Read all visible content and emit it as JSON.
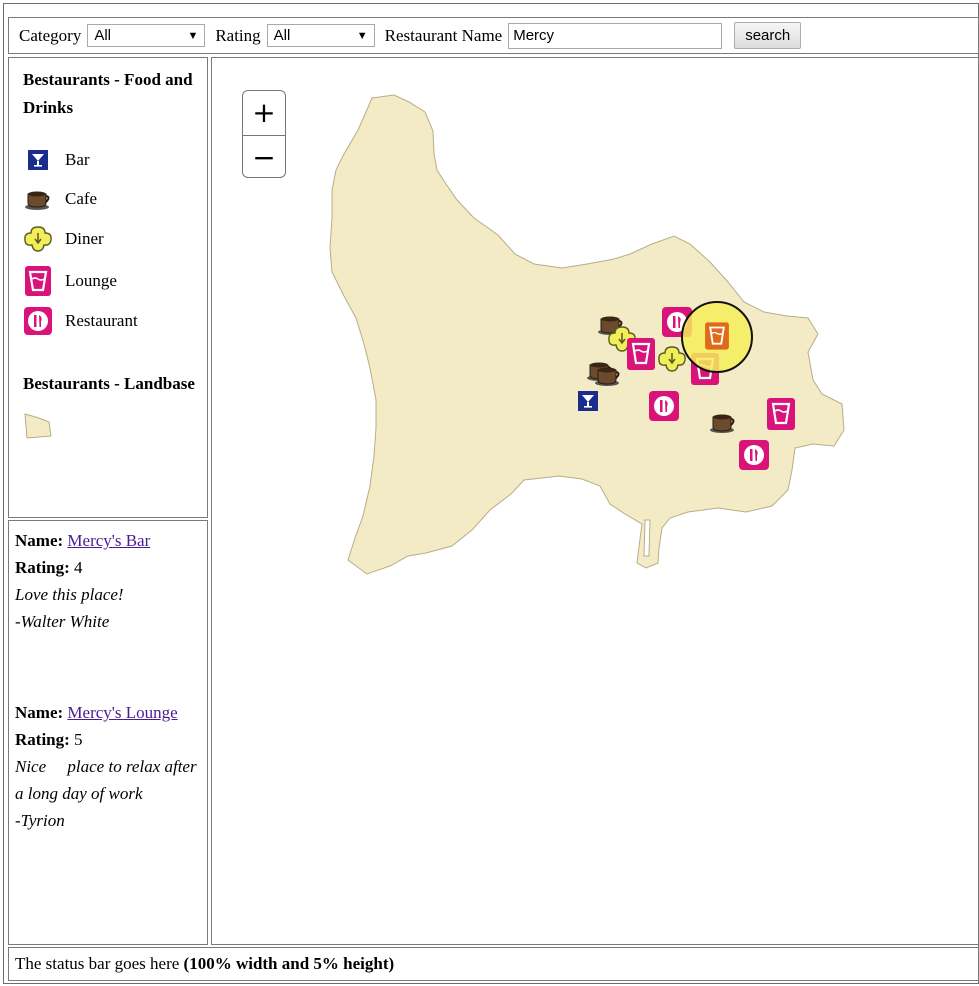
{
  "toolbar": {
    "category_label": "Category",
    "category_value": "All",
    "rating_label": "Rating",
    "rating_value": "All",
    "restaurant_name_label": "Restaurant Name",
    "restaurant_name_value": "Mercy",
    "search_button_label": "search"
  },
  "legend": {
    "section1_title": "Bestaurants - Food and Drinks",
    "items": [
      {
        "label": "Bar",
        "icon": "bar-icon",
        "color": "#1a2d8c"
      },
      {
        "label": "Cafe",
        "icon": "coffee-cup-icon",
        "color": "#6b4a2e"
      },
      {
        "label": "Diner",
        "icon": "diner-icon",
        "color": "#f2ee5a"
      },
      {
        "label": "Lounge",
        "icon": "lounge-icon",
        "color": "#d9137a"
      },
      {
        "label": "Restaurant",
        "icon": "restaurant-icon",
        "color": "#d9137a"
      }
    ],
    "section2_title": "Bestaurants - Landbase",
    "landbase_icon": "polygon-swatch-icon",
    "landbase_color": "#f3ebc6"
  },
  "info_panel": {
    "entries": [
      {
        "name_label": "Name:",
        "name": "Mercy's Bar",
        "rating_label": "Rating:",
        "rating": "4",
        "review": "Love this place!",
        "author": "-Walter White"
      },
      {
        "name_label": "Name:",
        "name": "Mercy's Lounge",
        "rating_label": "Rating:",
        "rating": "5",
        "review": "Nice     place to relax after a long day of work",
        "author": "-Tyrion"
      }
    ]
  },
  "map": {
    "zoom_in_label": "+",
    "zoom_out_label": "−",
    "land_color": "#f3ebc6",
    "highlight_color": "#f5ee5a"
  },
  "status_bar": {
    "text": "The status bar goes here ",
    "bold_text": "(100% width and 5% height)"
  }
}
